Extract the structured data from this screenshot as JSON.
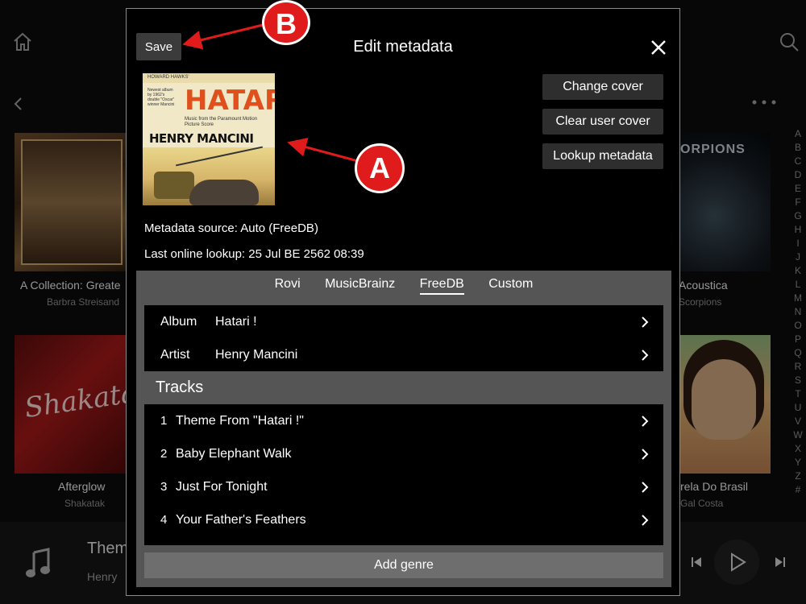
{
  "background": {
    "albums": [
      {
        "title": "A Collection: Greate",
        "artist": "Barbra Streisand"
      },
      {
        "title": "Afterglow",
        "artist": "Shakatak",
        "cover_text": "Shakatak"
      },
      {
        "title": "Acoustica",
        "artist": "Scorpions",
        "cover_text": "ORPIONS"
      },
      {
        "title": "rela Do Brasil",
        "artist": "Gal Costa"
      }
    ],
    "alphabet": [
      "A",
      "B",
      "C",
      "D",
      "E",
      "F",
      "G",
      "H",
      "I",
      "J",
      "K",
      "L",
      "M",
      "N",
      "O",
      "P",
      "Q",
      "R",
      "S",
      "T",
      "U",
      "V",
      "W",
      "X",
      "Y",
      "Z",
      "#"
    ],
    "now_playing": {
      "title": "Them",
      "artist": "Henry"
    }
  },
  "modal": {
    "save_label": "Save",
    "title": "Edit metadata",
    "album_art": {
      "topline": "HOWARD HAWKS'",
      "blurb": "Newest album by 1962's double \"Oscar\" winner Mancini",
      "title": "HATARI!",
      "subtitle": "Music from the Paramount Motion Picture Score",
      "artist": "HENRY MANCINI"
    },
    "buttons": {
      "change_cover": "Change cover",
      "clear_cover": "Clear user cover",
      "lookup": "Lookup metadata"
    },
    "metadata_source": "Metadata source:  Auto (FreeDB)",
    "last_lookup": "Last online lookup: 25 Jul BE 2562 08:39",
    "tabs": [
      "Rovi",
      "MusicBrainz",
      "FreeDB",
      "Custom"
    ],
    "active_tab": "FreeDB",
    "album": {
      "label": "Album",
      "value": "Hatari !"
    },
    "artist": {
      "label": "Artist",
      "value": "Henry Mancini"
    },
    "tracks_heading": "Tracks",
    "tracks": [
      {
        "num": "1",
        "name": "Theme From \"Hatari !\""
      },
      {
        "num": "2",
        "name": "Baby Elephant Walk"
      },
      {
        "num": "3",
        "name": "Just For Tonight"
      },
      {
        "num": "4",
        "name": "Your Father's Feathers"
      }
    ],
    "add_genre": "Add genre"
  },
  "annotations": {
    "a": "A",
    "b": "B",
    "color": "#e01b1b"
  }
}
